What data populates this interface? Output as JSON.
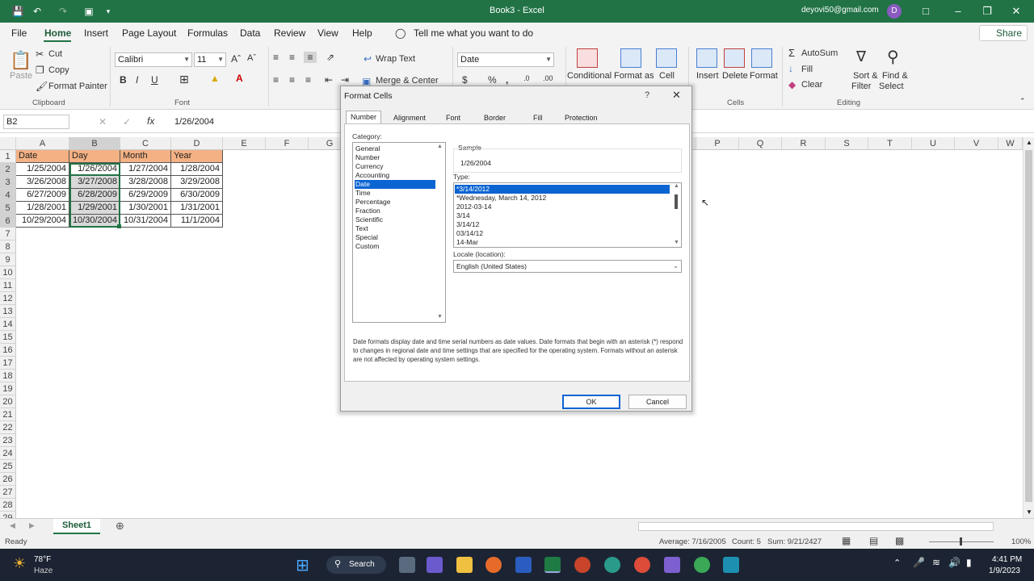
{
  "titlebar": {
    "app_title": "Book3  -  Excel",
    "account": "deyovi50@gmail.com",
    "avatar_letter": "D"
  },
  "menu": {
    "tabs": [
      "File",
      "Home",
      "Insert",
      "Page Layout",
      "Formulas",
      "Data",
      "Review",
      "View",
      "Help"
    ],
    "tell_me": "Tell me what you want to do",
    "share": "Share"
  },
  "ribbon": {
    "clipboard": {
      "paste": "Paste",
      "cut": "Cut",
      "copy": "Copy",
      "format_painter": "Format Painter",
      "group": "Clipboard"
    },
    "font": {
      "name": "Calibri",
      "size": "11",
      "group": "Font"
    },
    "alignment": {
      "wrap": "Wrap Text",
      "merge": "Merge & Center"
    },
    "number": {
      "format": "Date"
    },
    "styles": {
      "conditional": "Conditional",
      "format_as": "Format as",
      "cell": "Cell"
    },
    "cells": {
      "insert": "Insert",
      "delete": "Delete",
      "format": "Format",
      "group": "Cells"
    },
    "editing": {
      "autosum": "AutoSum",
      "fill": "Fill",
      "clear": "Clear",
      "sort": "Sort &",
      "filter": "Filter",
      "find": "Find &",
      "select": "Select",
      "group": "Editing"
    }
  },
  "formula_bar": {
    "name_box": "B2",
    "value": "1/26/2004"
  },
  "grid": {
    "columns": [
      "A",
      "B",
      "C",
      "D",
      "E",
      "F",
      "G",
      "P",
      "Q",
      "R",
      "S",
      "T",
      "U",
      "V",
      "W"
    ],
    "header_row": [
      "Date",
      "Day",
      "Month",
      "Year"
    ],
    "rows": [
      [
        "1/25/2004",
        "1/26/2004",
        "1/27/2004",
        "1/28/2004"
      ],
      [
        "3/26/2008",
        "3/27/2008",
        "3/28/2008",
        "3/29/2008"
      ],
      [
        "6/27/2009",
        "6/28/2009",
        "6/29/2009",
        "6/30/2009"
      ],
      [
        "1/28/2001",
        "1/29/2001",
        "1/30/2001",
        "1/31/2001"
      ],
      [
        "10/29/2004",
        "10/30/2004",
        "10/31/2004",
        "11/1/2004"
      ]
    ],
    "row_numbers": [
      "1",
      "2",
      "3",
      "4",
      "5",
      "6",
      "7",
      "8",
      "9",
      "10",
      "11",
      "12",
      "13",
      "14",
      "15",
      "16",
      "17",
      "18",
      "19",
      "20",
      "21",
      "22",
      "23",
      "24",
      "25",
      "26",
      "27",
      "28",
      "29"
    ]
  },
  "sheet_tab": "Sheet1",
  "status": {
    "ready": "Ready",
    "average": "Average: 7/16/2005",
    "count": "Count: 5",
    "sum": "Sum: 9/21/2427",
    "zoom": "100%"
  },
  "taskbar": {
    "temp": "78°F",
    "weather": "Haze",
    "search": "Search",
    "time": "4:41 PM",
    "date": "1/9/2023"
  },
  "dialog": {
    "title": "Format Cells",
    "help": "?",
    "tabs": [
      "Number",
      "Alignment",
      "Font",
      "Border",
      "Fill",
      "Protection"
    ],
    "category_label": "Category:",
    "categories": [
      "General",
      "Number",
      "Currency",
      "Accounting",
      "Date",
      "Time",
      "Percentage",
      "Fraction",
      "Scientific",
      "Text",
      "Special",
      "Custom"
    ],
    "sample_label": "Sample",
    "sample_value": "1/26/2004",
    "type_label": "Type:",
    "types": [
      "*3/14/2012",
      "*Wednesday, March 14, 2012",
      "2012-03-14",
      "3/14",
      "3/14/12",
      "03/14/12",
      "14-Mar"
    ],
    "locale_label": "Locale (location):",
    "locale": "English (United States)",
    "description": "Date formats display date and time serial numbers as date values.  Date formats that begin with an asterisk (*) respond to changes in regional date and time settings that are specified for the operating system. Formats without an asterisk are not affected by operating system settings.",
    "ok": "OK",
    "cancel": "Cancel"
  }
}
